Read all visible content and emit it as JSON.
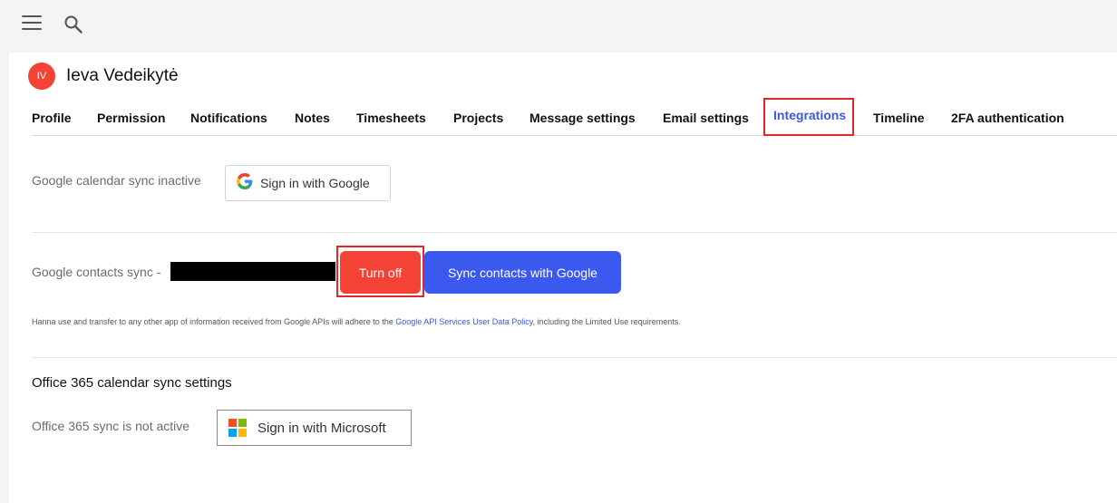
{
  "user": {
    "initials": "IV",
    "name": "Ieva Vedeikytė",
    "avatar_color": "#f44336"
  },
  "tabs": [
    {
      "label": "Profile",
      "active": false
    },
    {
      "label": "Permission",
      "active": false
    },
    {
      "label": "Notifications",
      "active": false
    },
    {
      "label": "Notes",
      "active": false
    },
    {
      "label": "Timesheets",
      "active": false
    },
    {
      "label": "Projects",
      "active": false
    },
    {
      "label": "Message settings",
      "active": false
    },
    {
      "label": "Email settings",
      "active": false
    },
    {
      "label": "Integrations",
      "active": true
    },
    {
      "label": "Timeline",
      "active": false
    },
    {
      "label": "2FA authentication",
      "active": false
    }
  ],
  "google_calendar": {
    "status": "Google calendar sync inactive",
    "sign_in_label": "Sign in with Google"
  },
  "google_contacts": {
    "status": "Google contacts sync -",
    "turn_off_label": "Turn off",
    "sync_label": "Sync contacts with Google"
  },
  "policy": {
    "text_before": "Hanna use and transfer to any other app of information received from Google APIs will adhere to the ",
    "link_text": "Google API Services User Data Policy",
    "text_after": ", including the Limited Use requirements."
  },
  "office365": {
    "title": "Office 365 calendar sync settings",
    "status": "Office 365 sync is not active",
    "sign_in_label": "Sign in with Microsoft"
  },
  "colors": {
    "accent": "#3b58ef",
    "danger": "#f44336",
    "highlight": "#e0262b"
  },
  "icons": [
    "menu-icon",
    "search-icon",
    "google-logo-icon",
    "microsoft-logo-icon"
  ]
}
